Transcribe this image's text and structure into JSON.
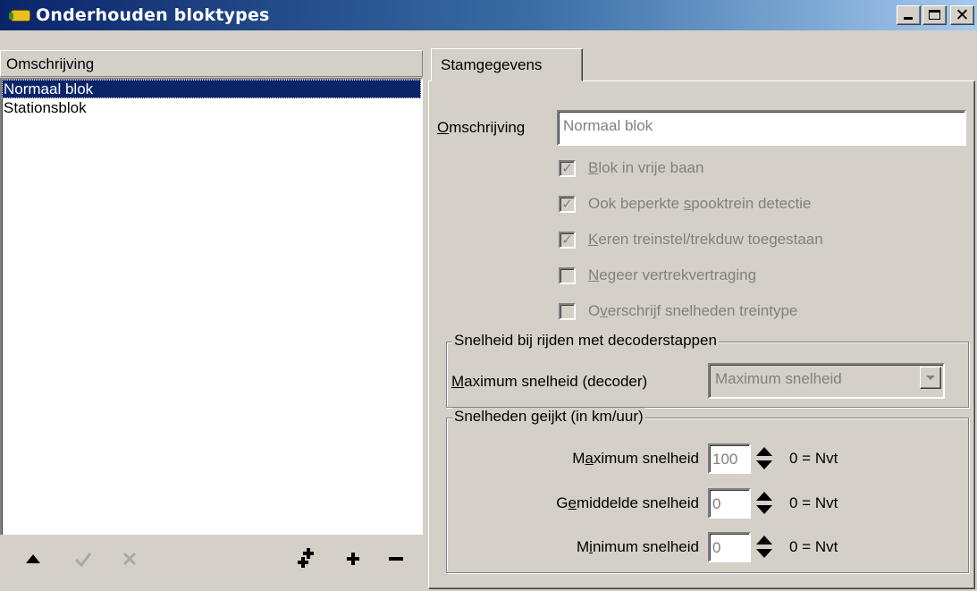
{
  "window": {
    "title": "Onderhouden bloktypes"
  },
  "list": {
    "header": "Omschrijving",
    "items": [
      "Normaal blok",
      "Stationsblok"
    ],
    "selected_index": 0
  },
  "toolbar": {
    "buttons": [
      {
        "icon": "arrow-up-icon",
        "glyph": "▲",
        "enabled": true
      },
      {
        "icon": "check-icon",
        "glyph": "✓",
        "enabled": false
      },
      {
        "icon": "cross-icon",
        "glyph": "✕",
        "enabled": false
      },
      {
        "icon": "add-multiple-icon",
        "glyph": "✚",
        "enabled": true
      },
      {
        "icon": "add-icon",
        "glyph": "+",
        "enabled": true
      },
      {
        "icon": "remove-icon",
        "glyph": "−",
        "enabled": true
      }
    ]
  },
  "tabs": [
    {
      "label": "Stamgegevens",
      "active": true
    }
  ],
  "form": {
    "omschrijving": {
      "label_first": "O",
      "label_rest": "mschrijving",
      "value": "Normaal blok"
    },
    "checkboxes": [
      {
        "pre": "",
        "u": "B",
        "post": "lok in vrije baan",
        "checked": true
      },
      {
        "pre": "Ook beperkte ",
        "u": "s",
        "post": "pooktrein detectie",
        "checked": true
      },
      {
        "pre": "",
        "u": "K",
        "post": "eren treinstel/trekduw toegestaan",
        "checked": true
      },
      {
        "pre": "",
        "u": "N",
        "post": "egeer vertrekvertraging",
        "checked": false
      },
      {
        "pre": "O",
        "u": "v",
        "post": "erschrijf snelheden treintype",
        "checked": false
      }
    ],
    "decoder_group": {
      "title": "Snelheid bij rijden met decoderstappen",
      "label_first": "M",
      "label_rest": "aximum snelheid (decoder)",
      "selected": "Maximum snelheid"
    },
    "speeds_group": {
      "title": "Snelheden geijkt (in km/uur)",
      "note": "0 = Nvt",
      "rows": [
        {
          "pre": "M",
          "u": "a",
          "post": "ximum snelheid",
          "value": "100"
        },
        {
          "pre": "G",
          "u": "e",
          "post": "middelde snelheid",
          "value": "0"
        },
        {
          "pre": "M",
          "u": "i",
          "post": "nimum snelheid",
          "value": "0"
        }
      ]
    }
  },
  "colors": {
    "title_start": "#0a246a",
    "title_end": "#a6caf0",
    "selection": "#0a246a",
    "face": "#d4d0c8",
    "disabled_text": "#808080"
  }
}
